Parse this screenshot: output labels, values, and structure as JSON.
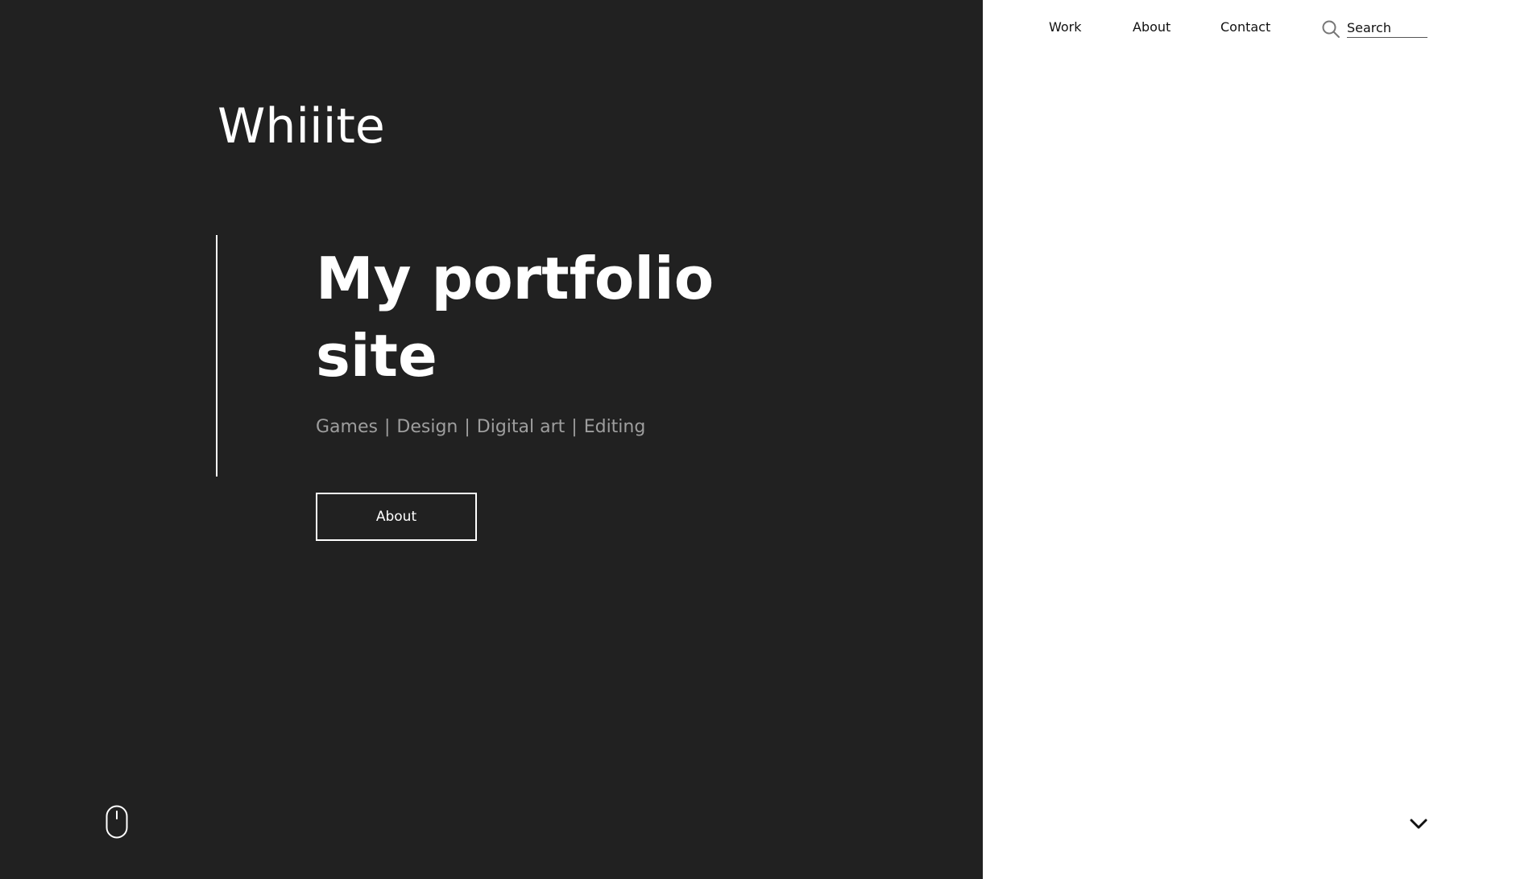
{
  "brand": {
    "name": "Whiiite"
  },
  "nav": {
    "items": [
      {
        "label": "Work"
      },
      {
        "label": "About"
      },
      {
        "label": "Contact"
      }
    ],
    "search": {
      "placeholder": "Search",
      "icon": "search-icon"
    }
  },
  "hero": {
    "title": "My portfolio site",
    "subtitle_items": [
      "Games",
      "Design",
      "Digital art",
      "Editing"
    ],
    "separator": "|",
    "button_label": "About"
  },
  "icons": {
    "scroll_hint": "mouse-icon",
    "scroll_down": "chevron-down-icon"
  },
  "colors": {
    "left_background": "#212121",
    "right_background": "#ffffff",
    "hero_text": "#ffffff",
    "subtitle_text": "#9e9e9e"
  }
}
